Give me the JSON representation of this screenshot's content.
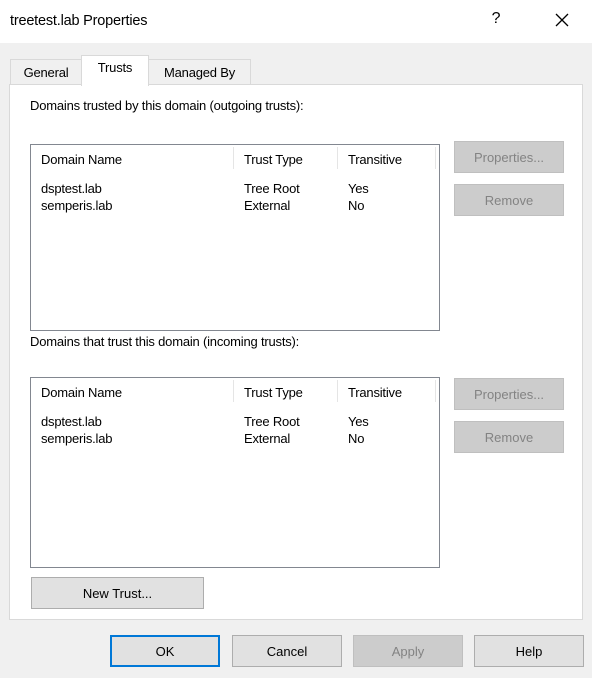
{
  "window": {
    "title": "treetest.lab Properties",
    "help_glyph": "?",
    "close_icon": "close-icon"
  },
  "tabs": [
    {
      "label": "General",
      "selected": false
    },
    {
      "label": "Trusts",
      "selected": true
    },
    {
      "label": "Managed By",
      "selected": false
    }
  ],
  "outgoing": {
    "label": "Domains trusted by this domain (outgoing trusts):",
    "columns": [
      "Domain Name",
      "Trust Type",
      "Transitive"
    ],
    "rows": [
      [
        "dsptest.lab",
        "Tree Root",
        "Yes"
      ],
      [
        "semperis.lab",
        "External",
        "No"
      ]
    ],
    "properties_label": "Properties...",
    "remove_label": "Remove",
    "properties_enabled": false,
    "remove_enabled": false
  },
  "incoming": {
    "label": "Domains that trust this domain (incoming trusts):",
    "columns": [
      "Domain Name",
      "Trust Type",
      "Transitive"
    ],
    "rows": [
      [
        "dsptest.lab",
        "Tree Root",
        "Yes"
      ],
      [
        "semperis.lab",
        "External",
        "No"
      ]
    ],
    "properties_label": "Properties...",
    "remove_label": "Remove",
    "properties_enabled": false,
    "remove_enabled": false
  },
  "new_trust_label": "New Trust...",
  "footer": {
    "ok_label": "OK",
    "cancel_label": "Cancel",
    "apply_label": "Apply",
    "help_label": "Help",
    "apply_enabled": false
  },
  "colors": {
    "focus_border": "#0078d7",
    "disabled_text": "#838383",
    "listbox_border": "#828790"
  }
}
